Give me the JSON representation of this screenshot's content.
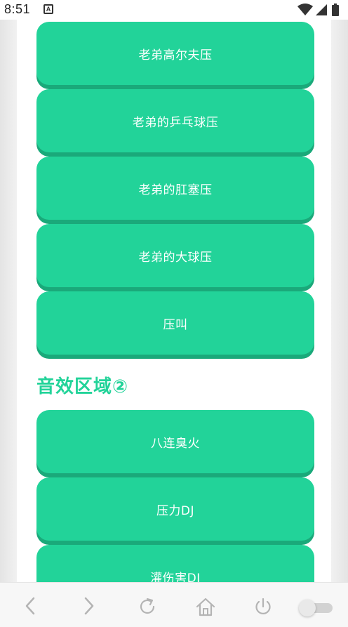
{
  "status_bar": {
    "time": "8:51",
    "notification_glyph": "A",
    "icons": [
      "wifi-icon",
      "signal-icon",
      "battery-icon"
    ]
  },
  "sound_buttons_group1": [
    {
      "label": "老弟高尔夫压"
    },
    {
      "label": "老弟的乒乓球压"
    },
    {
      "label": "老弟的肛塞压"
    },
    {
      "label": "老弟的大球压"
    },
    {
      "label": "压叫"
    }
  ],
  "section2": {
    "title": "音效区域②",
    "buttons": [
      {
        "label": "八连臭火"
      },
      {
        "label": "压力DJ"
      },
      {
        "label": "灌伤害DJ"
      }
    ]
  },
  "bottom_bar": {
    "icons": [
      "back-icon",
      "forward-icon",
      "refresh-icon",
      "home-icon",
      "power-icon",
      "toggle-switch"
    ]
  },
  "colors": {
    "accent": "#22d399",
    "accent_shadow": "#1aa97a",
    "page_bg": "#ffffff",
    "gutter_bg": "#ececec"
  }
}
